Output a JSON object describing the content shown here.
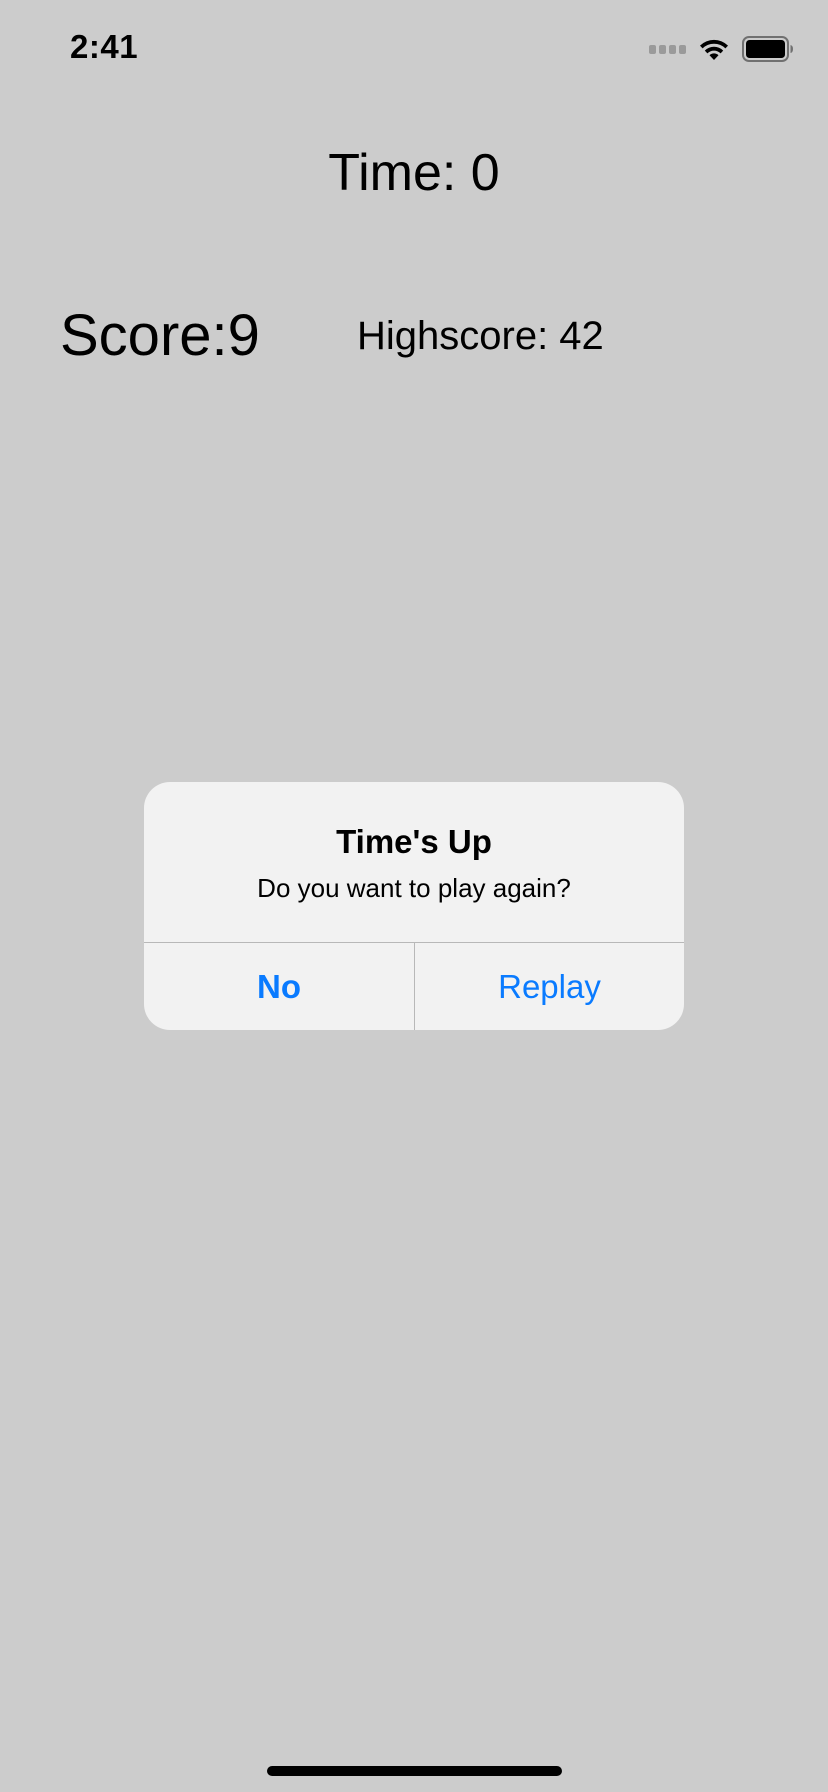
{
  "status_bar": {
    "time": "2:41",
    "icons": [
      "cellular-signal-icon",
      "wifi-icon",
      "battery-icon"
    ]
  },
  "game": {
    "time_label": "Time: 0",
    "score_label": "Score:9",
    "highscore_label": "Highscore: 42"
  },
  "alert": {
    "title": "Time's Up",
    "message": "Do you want to play again?",
    "buttons": {
      "no_label": "No",
      "replay_label": "Replay"
    }
  },
  "colors": {
    "background": "#cccccc",
    "alert_background": "#f2f2f2",
    "accent": "#0a7bff"
  }
}
